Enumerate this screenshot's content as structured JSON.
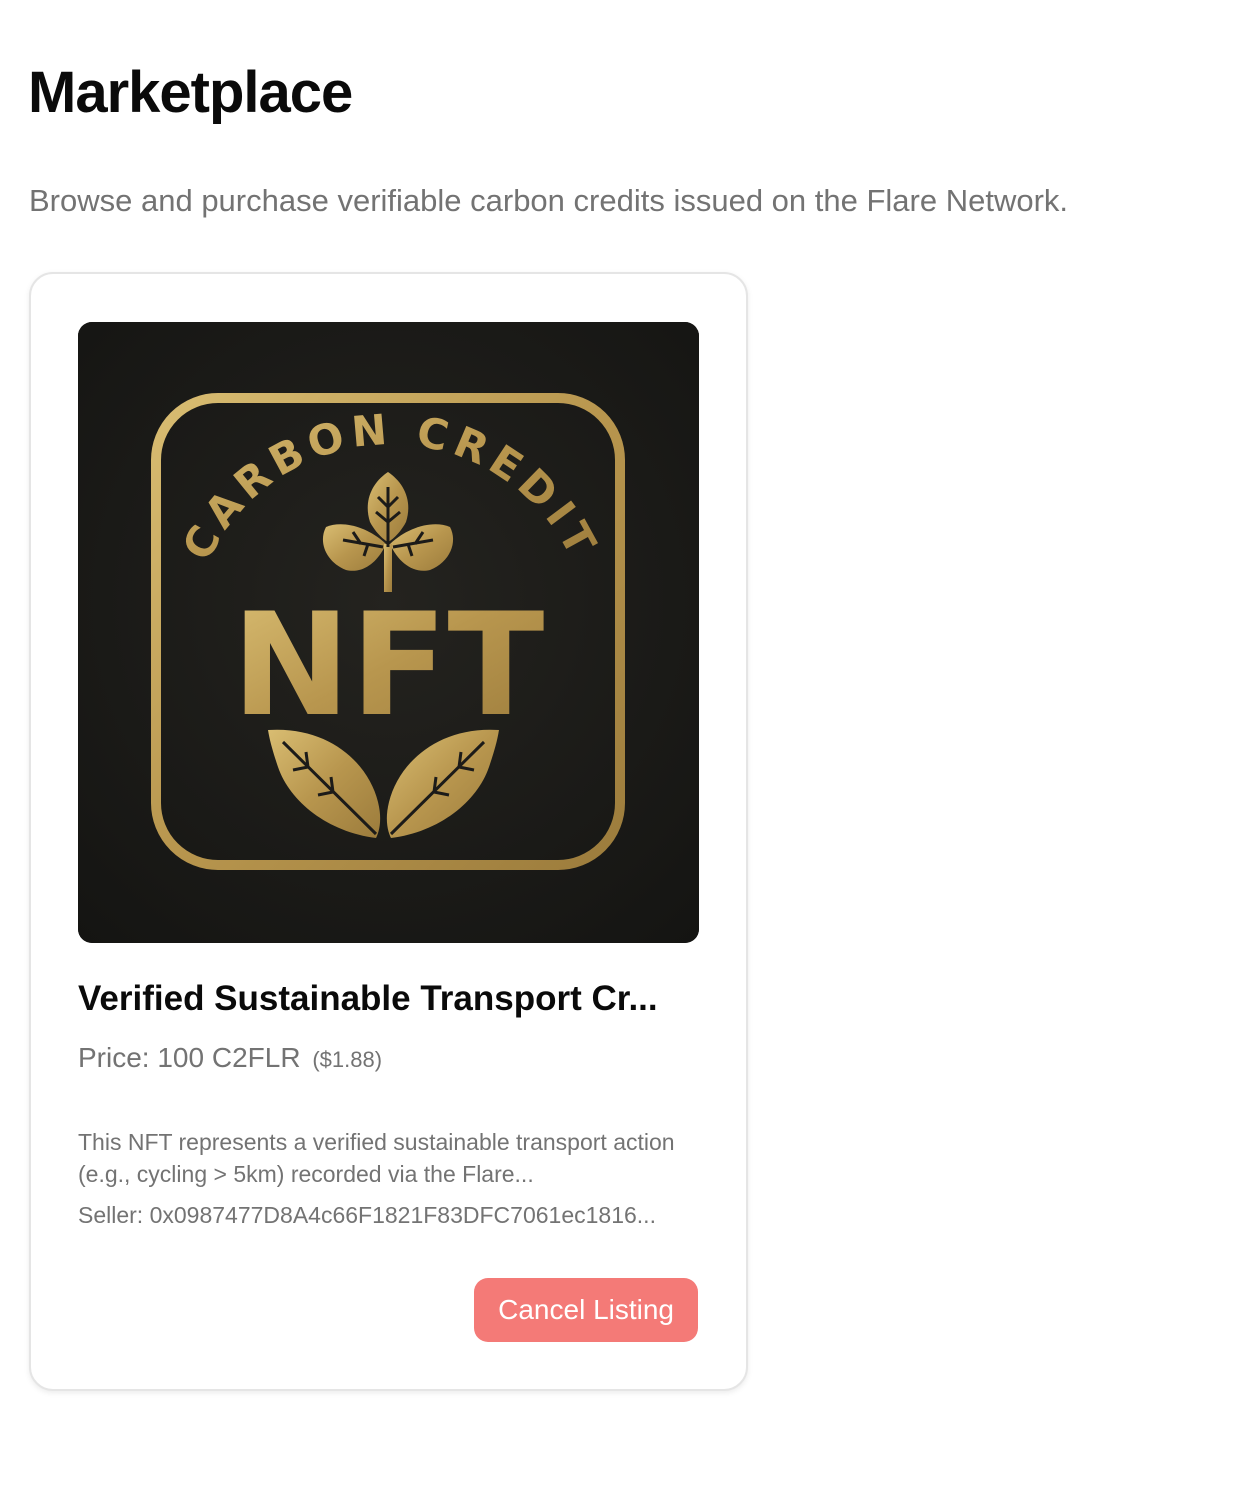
{
  "header": {
    "title": "Marketplace",
    "subtitle": "Browse and purchase verifiable carbon credits issued on the Flare Network."
  },
  "listing": {
    "image_icon": "carbon-credit-nft-badge",
    "image_text_arc": "CARBON CREDIT",
    "image_text_main": "NFT",
    "title": "Verified Sustainable Transport Cr...",
    "price_label": "Price:",
    "price_value": "100 C2FLR",
    "price_usd": "($1.88)",
    "description": "This NFT represents a verified sustainable transport action (e.g., cycling > 5km) recorded via the Flare...",
    "seller_label": "Seller:",
    "seller_address": "0x0987477D8A4c66F1821F83DFC7061ec1816...",
    "action_label": "Cancel Listing"
  },
  "colors": {
    "action_button": "#f47a77",
    "muted_text": "#737373",
    "gold": "#c2a25a",
    "image_background": "#1c1b19"
  }
}
